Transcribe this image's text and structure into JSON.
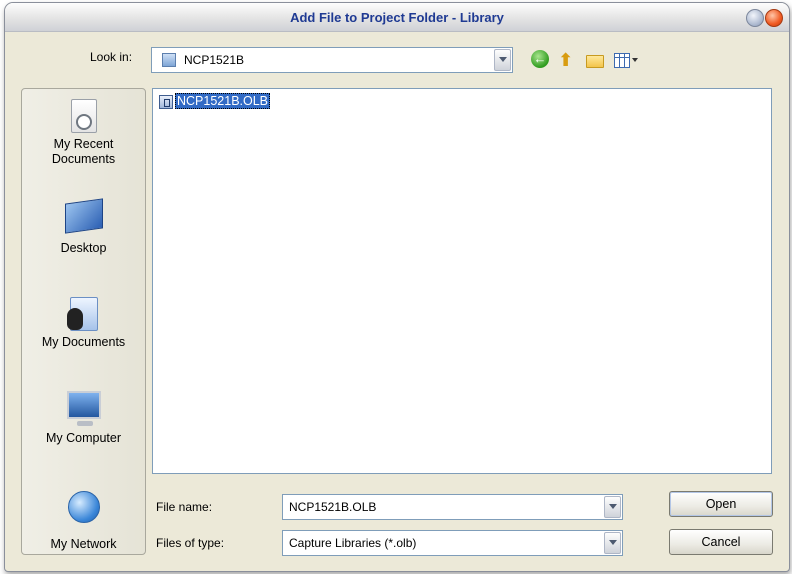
{
  "window": {
    "title": "Add File to Project Folder - Library"
  },
  "toolbar": {
    "look_in_label": "Look in:",
    "look_in_value": "NCP1521B",
    "icons": [
      "back-icon",
      "up-folder-icon",
      "new-folder-icon",
      "view-menu-icon"
    ]
  },
  "places": [
    {
      "label": "My Recent Documents",
      "icon": "recent-documents-icon"
    },
    {
      "label": "Desktop",
      "icon": "desktop-icon"
    },
    {
      "label": "My Documents",
      "icon": "my-documents-icon"
    },
    {
      "label": "My Computer",
      "icon": "my-computer-icon"
    },
    {
      "label": "My Network",
      "icon": "my-network-icon"
    }
  ],
  "files": [
    {
      "name": "NCP1521B.OLB",
      "selected": true
    }
  ],
  "form": {
    "file_name_label": "File name:",
    "file_name_value": "NCP1521B.OLB",
    "file_type_label": "Files of type:",
    "file_type_value": "Capture Libraries (*.olb)"
  },
  "buttons": {
    "open": "Open",
    "cancel": "Cancel"
  },
  "colors": {
    "title": "#1f3a93",
    "selection": "#316ac5",
    "dialog_bg": "#ece9d8"
  }
}
